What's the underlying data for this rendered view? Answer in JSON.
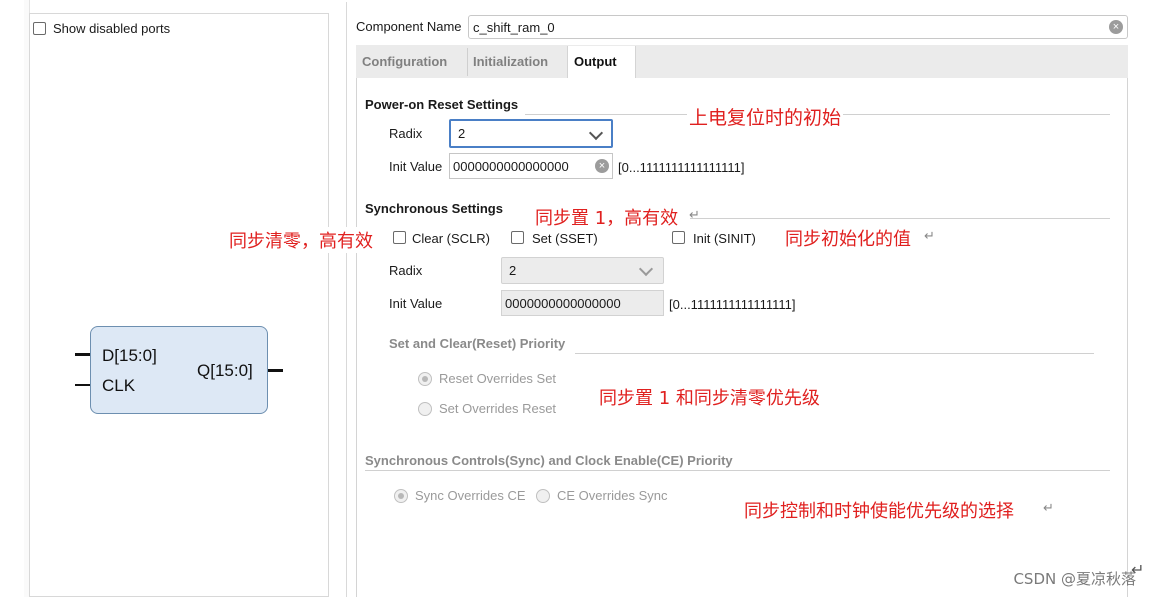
{
  "left": {
    "show_disabled_ports": "Show disabled ports",
    "symbol": {
      "port_d": "D[15:0]",
      "port_clk": "CLK",
      "port_q": "Q[15:0]"
    }
  },
  "component": {
    "label": "Component Name",
    "value": "c_shift_ram_0"
  },
  "tabs": [
    {
      "label": "Configuration",
      "active": false
    },
    {
      "label": "Initialization",
      "active": false
    },
    {
      "label": "Output",
      "active": true
    }
  ],
  "power_on": {
    "title": "Power-on Reset Settings",
    "radix_label": "Radix",
    "radix_value": "2",
    "init_label": "Init Value",
    "init_value": "0000000000000000",
    "range": "[0...1111111111111111]"
  },
  "sync": {
    "title": "Synchronous Settings",
    "clear_label": "Clear (SCLR)",
    "set_label": "Set (SSET)",
    "init_label": "Init (SINIT)",
    "radix_label": "Radix",
    "radix_value": "2",
    "init_value_label": "Init Value",
    "init_value": "0000000000000000",
    "range": "[0...1111111111111111]"
  },
  "priority": {
    "title": "Set and Clear(Reset) Priority",
    "option_reset": "Reset Overrides Set",
    "option_set": "Set Overrides Reset"
  },
  "ce_priority": {
    "title": "Synchronous Controls(Sync) and Clock Enable(CE) Priority",
    "option_sync": "Sync Overrides CE",
    "option_ce": "CE Overrides Sync"
  },
  "annotations": {
    "power_on_init": "上电复位时的初始",
    "sync_set": "同步置 1，高有效",
    "sync_clear": "同步清零，高有效",
    "sync_init": "同步初始化的值",
    "priority_note": "同步置  1  和同步清零优先级",
    "ce_note": "同步控制和时钟使能优先级的选择"
  },
  "watermark": "CSDN @夏凉秋落",
  "colors": {
    "annotation": "#e0201f",
    "focus_border": "#4a7fc6",
    "symbol_fill": "#dde8f5"
  }
}
